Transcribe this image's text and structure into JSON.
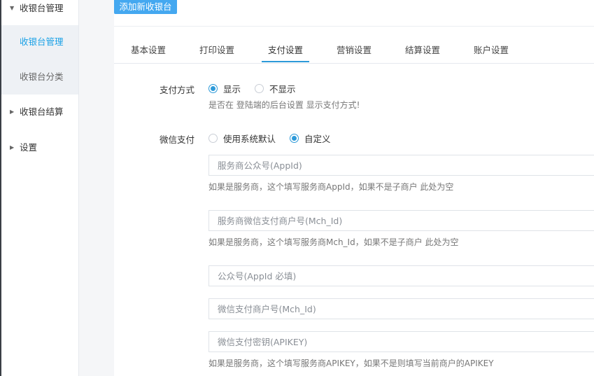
{
  "sidebar": {
    "groups": [
      {
        "label": "收银台管理",
        "caret": "▼"
      },
      {
        "label": "收银台结算",
        "caret": "▶"
      },
      {
        "label": "设置",
        "caret": "▶"
      }
    ],
    "sub_items": [
      {
        "label": "收银台管理",
        "active": true
      },
      {
        "label": "收银台分类",
        "active": false
      }
    ]
  },
  "toolbar": {
    "add_label": "添加新收银台"
  },
  "tabs": [
    {
      "label": "基本设置",
      "active": false
    },
    {
      "label": "打印设置",
      "active": false
    },
    {
      "label": "支付设置",
      "active": true
    },
    {
      "label": "营销设置",
      "active": false
    },
    {
      "label": "结算设置",
      "active": false
    },
    {
      "label": "账户设置",
      "active": false
    }
  ],
  "form": {
    "payment_method": {
      "label": "支付方式",
      "options": [
        {
          "label": "显示",
          "checked": true
        },
        {
          "label": "不显示",
          "checked": false
        }
      ],
      "hint": "是否在 登陆端的后台设置 显示支付方式!"
    },
    "wechat_pay": {
      "label": "微信支付",
      "options": [
        {
          "label": "使用系统默认",
          "checked": false
        },
        {
          "label": "自定义",
          "checked": true
        }
      ],
      "fields": [
        {
          "placeholder": "服务商公众号(AppId)",
          "value": ""
        },
        {
          "placeholder": "服务商微信支付商户号(Mch_Id)",
          "value": ""
        },
        {
          "placeholder": "公众号(AppId 必填)",
          "value": ""
        },
        {
          "placeholder": "微信支付商户号(Mch_Id)",
          "value": ""
        },
        {
          "placeholder": "微信支付密钥(APIKEY)",
          "value": ""
        }
      ],
      "hints": [
        "如果是服务商，这个填写服务商AppId，如果不是子商户 此处为空",
        "如果是服务商，这个填写服务商Mch_Id，如果不是子商户 此处为空",
        "如果是服务商，这个填写服务商APIKEY，如果不是则填写当前商户的APIKEY"
      ]
    }
  },
  "colors": {
    "accent": "#2d9ad9",
    "button": "#44a8f0",
    "active_nav_text": "#1aa1e6"
  }
}
